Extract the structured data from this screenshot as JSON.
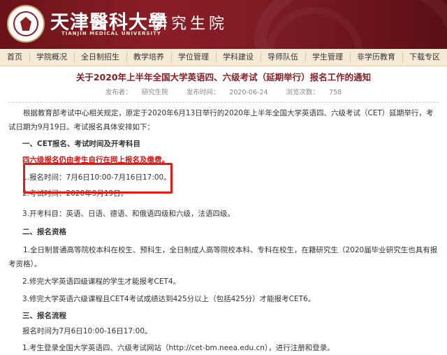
{
  "header": {
    "university_name": "天津醫科大學",
    "university_en": "TIANJIN MEDICAL UNIVERSITY",
    "school_name": "研究生院"
  },
  "nav": {
    "items": [
      "首页",
      "学院概况",
      "全日制招生",
      "教学培养",
      "学位管理",
      "学科建设",
      "导师队伍",
      "学生管理",
      "非学历教育",
      "下载专区"
    ]
  },
  "article": {
    "title": "关于2020年上半年全国大学英语四、六级考试（延期举行）报名工作的通知",
    "meta": {
      "publisher_label": "发布者：",
      "publisher": "研究生院",
      "time_label": "发布时间：",
      "time": "2020-06-24",
      "views_label": "浏览次数：",
      "views": "758"
    },
    "intro": "根据教育部考试中心相关规定，原定于2020年6月13日举行的2020年上半年全国大学英语四、六级考试（CET）延期举行，考试日期为9月19日。考试报名具体安排如下：",
    "section1_title": "一、CET报名、考试时间及开考科目",
    "section1_notice": "四六级报名仍由考生自行在网上报名及缴费。",
    "section1_item1": "1.报名时间：7月6日10:00-7月16日17:00。",
    "section1_item2": "2.考试时间：2020年9月19日。",
    "section1_item3": "3.开考科目：英语、日语、德语、和俄语四级和六级，法语四级。",
    "section2_title": "二、报名资格",
    "section2_item1": "1.全日制普通高等院校本科在校生、预科生，全日制成人高等院校本科、专科在校生，在籍研究生（2020届毕业研究生也具有报考资格）。",
    "section2_item2": "2.修完大学英语四级课程的学生才能报考CET4。",
    "section2_item3": "3.修完大学英语六级课程且CET4考试成绩达到425分以上（包括425分）才能报考CET6。",
    "section3_title": "三、报名流程",
    "section3_time": "报名时间为7月6日10:00-16日17:00。",
    "section3_item1": "1.考生登录全国大学英语四、六级考试网站（http://cet-bm.neea.edu.cn），进行注册和登录。"
  },
  "colors": {
    "header_bg": "#7a1a22",
    "nav_bg": "#f5ead6",
    "title": "#8a1e26",
    "notice_red": "#e01010",
    "highlight_box": "#e41b14"
  }
}
